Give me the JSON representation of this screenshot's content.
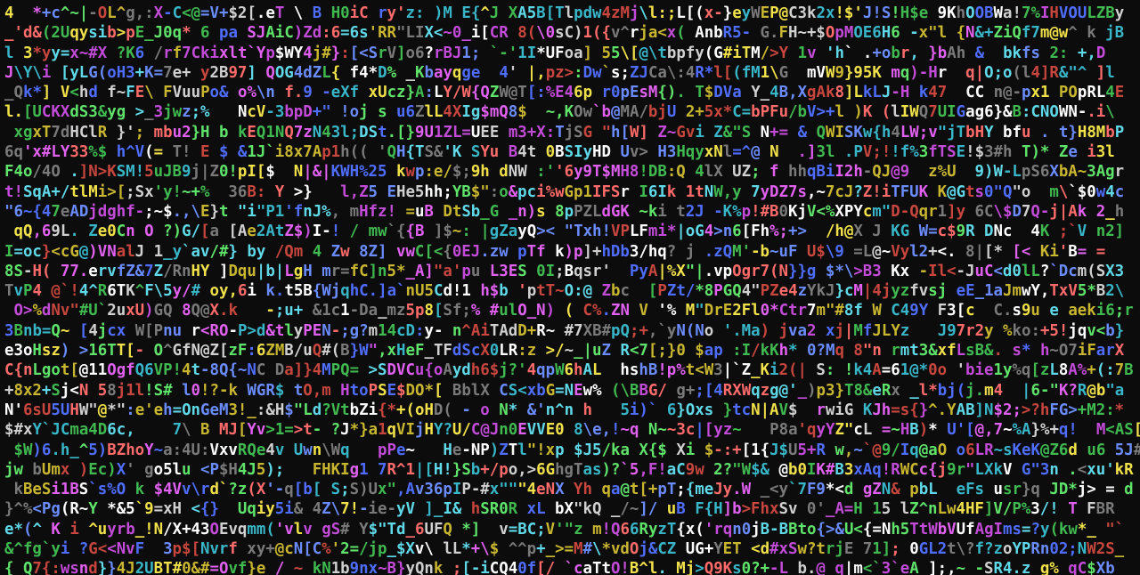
{
  "terminal": {
    "background": "#0c0c0c",
    "palette": [
      "#c7463e",
      "#3fb950",
      "#c9b630",
      "#4f6dff",
      "#c24bd8",
      "#38b6c8",
      "#d0d0d0",
      "#7a7a7a",
      "#ff6b6b",
      "#5fe36a",
      "#f0e04a",
      "#6b8cff",
      "#e060f0",
      "#5fd8e8",
      "#ffffff"
    ],
    "lines": [
      "4  *+c^~|-OL^g,:X-C<@=V+$2[.eT \\ B H0iC ry'z: )M E{^J XA5B[Tlpdw4zMj\\l:;L[(x-}eyWEP@C3k2x!$'J!S!H$e 9KhOOBWa!7%IHVOULZBy",
      "_'d&(2Uqysib>pE_J0q* 6 pa SJAiC)Zd:6=6s'RR\"LIX<~0_i[CR 8(\\0sC)1({v^rja<x( AnbR5- G.FH~+$OpMOE6H6 -x\"l {N&+ZiQf7m@w^ k jB",
      "l 3*yy=x~#X ?K6 /rf7Ckixlt`Yp$WY4j#}:[<SrV]o6?rBJ1; `-'1I*UFoa] 55\\[@\\tbpfy(G#iTM/>Y 1v 'h` .+obr, }bAh &  bkfs 2: +,D",
      "J\\Y\\i [yLG(oH3+K=7e+ y2B97] QOG4dZL{ f4*D% _Kbayqge  4' |,pz>:Dw`s;ZJCa\\:4R*l[(fM1\\G  mVW9}95K mq)-Hr  q|O;o(l4]R&\"^ ]l",
      "_Qk*] V<hd f~FE\\ FVuuPo& o%\\n f.9 -eXf xUcz}A:LY/W{QZW@T[:%E46p r0pEsM{). T$DVa Y_4B,XgAk8]LkLJ-H k47  CC n@-px1 POpRL4E",
      "l.[UCKXdS3&yg >_3jwz;%   NcV-3bpD+\" !oj s u6ZlL4XIg$mQ8$  ~,KOw`b@MA/bjU 2+5x*C=bPFu/bV>+l )K (lIWQ7UIGag6}&B:CNOWN-.i\\",
      " xgxT7dHClR }'; mbu2}H b kEQ1NQ7zN43l;DSt.[}9U1ZL=UEE m3+X:TjSG \"h[W] Z~Gvi Z&\"S N+= & QWISKw{h4LW;v\"jTbHY bfu . t}H8MbP",
      "6q'x#LY33%$ h^V(= T! E $ &1J`i8x7Ap1h(( 'QH{TS&'K SYu B4t 0BSIyHD Uv> H3HqyxNl=^@ N  .]3l .PV;!!f%3fTSE!$3#h T)* Ze i3l",
      "F4o/4O .]N>KSM!5uJB9j|Z0!pI[$  N|&|KWH%25 kwp:e/$;9h dNW :''6y9T$MH8!DB:Q 4lX UZ; f hhqBiI2h-QJ@9  z%U  9)W-LpS6XbA~3Agr",
      "t!SqA+/tlMi>[;Sx'y!~+%  36B: Y >}   l,Z5 EHe5hh;YB$\":o&pci%wGp1IFSr I6Ik 1tNW,y 7yDZ7s,~7cJ?Z!iTFUK K@Gts0\"Q\"o  m\\`$0w4c",
      "\"6~{47eADjdghf-;~$.,\\E}t \"i\"P1'fnJ%, mHfz! =uB DtSb_G _n)s 8pPZLdGK ~ki t2J -K%p!#B0KjV<%XPYcm\"D-Qqr1]y 6C\\$D7Q-j|Ak 2_h",
      " qQ,69L. Ze0Cn O ?)G/[a [Ae2AtZ$)I-! / mw`{{B ]$~: |gZayQ>< \"Txh!VPLFmi*|oG4>n6[Fh%;+>  /h@X J KG W=c$9R DNc  4K ;`V n2]",
      "I=oc}<cG@)VNalJ 1_y`av/#} by /Qm 4 Zw 8Z] vwC[<{0EJ.zw pTf k)p]+hDb3/hq? j .zQM'-b~uF U$\\9 =L@~Vyl2+<. 8|[* [< Ki'B= =",
      "8S-H( 77.ervfZ&7Z/RnHY ]Dqu|b|LgH mr=fC]n5*_A]\"a'pu L3ES 0I;Bqsr'  PyA|%X\"|.vpOgr7(N}}g $*\\>B3 Kx -Il<-JuC<d0lL?`Dcm(SX3",
      "TvP4 @`!4^R6TK^F\\5y/# oy,6i k.t5B{WjqhC.]a`nU5Cd!1 h$b 'ptT~O:@ Zbc  [PZt/*8PGQ4\"PZe4zYkJ}cM|4jyzfvsj eE_1aJmwY,TxV5*B2\\",
      " O>%dNv\"#U`2uxU)GQ 8Q@X.k   -;u+ &1c1-Da_mz5p8[Sf;% #ulO_N) ( C%.ZN V '% M\"DrE2Fl0*Ctr7m\"#8f W C49Y F3[c  C.s9u e aeki6;r",
      "3Bnb=Q~ [4jcx W[Pnu r<RO-P>d&tlyPEN-;g?m14cD:y- n^AiTAdD+R~ #7XB#pQ;+,`yN(No '.Ma) jva2 xj|MfJLYz   J97r2y %ko:+5!jqv<b}",
      "e3oHsz) >16TT[- O^GfN@Z[zF:6ZMB/uQ#(B}W\",xHeF_TFdScX0LR:z >/~_|uZ R<7[;}0 $ap :I/kKh* 0?Mq 8\"n rmt3&xfLsB&. s* h~O7iFarX",
      "C{nLgot[@11OgfQ6VP!4t-8Q{~NC Da]}4MPQ= >SDVCu{oAydh6$j?'4qpW6hAL  hshB!p%t<W3|`Z_Ki2(| S: !k4A=61@*0o 'bie1y%q[zL8A%+(:7B",
      "+8x2+Sj<N 58j1l!S# l0!?-k WGR$ tO,m HtoPSE$DO*[ BblX CS<xbG=NEw% (\\BBG/ g+;[4RXWqzg@'_)p3}T8&eRx _l*bj(j.m4  |6-\"K?R@b\"a",
      "N'6sU5UHW\"@*\":e'eh=OnGeM3!_:&H$\"Ld?VtbZi{*+(oHD( - o N* &'n^n h   5i)` 6}Oxs }tcN|AV$  rwiG KJh=s{}^.YAB]N$2;>?hFG>+M2:*",
      "$#xY`JCma4D6c,    7\\ B MJ[Yv>1=>t- ?J*}a1qVIjHY?U/C@Jn0EVVE0 8\\e,!~q N~~3c|[yz~   P8a'qyYZ\"cL =~HB)* U'[@,7~%A}%+q!  M<AS[",
      " $W)6.h_^5)BZhoY~a:4U:VxvRQe4v Uwn\\Wq   pPe~   He-NP)ZTl\"!xp $J5/ka X{$ Xi $-:+[1{J$U5+R w,~`@9/Iq@aO o6LR~sKeK@Z6d u6 5J#",
      "jw bUmx )Ec)X' go5lu <P$H4J5);   FHKIg1 7R^1|[H!}Sb+/po,>6GhgTas)?`5,F!aC9w 2?\"W$& @b0IK#B3xAq!RWCc{j9r\"LXkV G\"3n .<xu'kR",
      " kBeSi1BS`s%O k $4Vv\\rd`?z(X'-q[b[ S;S)Ux\",Av36pIP-#x\"\"\"4eNX Yh qa@t[+pT;{meJy.W _<y`7F9*<d gZN& pbL  eFs usr}q JD*j> = d",
      "}^%<Pg(R~Y *&5`9=xH <{}  Uqiy5i& 4Z\\7!-ie-yV ]_I& hSR0R xL bX\"kQ _/~]/ uB F{H]b>FhxSv 0'_A=H 15 lZ^nLw4HF]V/P%3/! T FBR",
      "e*(^ K i ^uyrb_!N/X+43OEvqmm('vlv gS# Y$\"Td_6UFQ *]  v=BC;V'\"z m!Q66RyzT{x('rqn0jB-BBto{>&U<{=Nh5TtWbVUfAgIms=?y(kw*_ \"`",
      "&^fg`yi ?G<<NvF  3p$[Nvrf xy+@cN[C%'2=/jp_$Xv\\ lL*+\\$ ^^p+_>=M#\\*vdOj&CZ UG+YET <d#xSw?trjE 71]; 0GL2t\\?f?zoYPRn02;NW2S_",
      "{ Q7{:wsnd}}4J2UBT#0&#=Ovf}e / ~ kN1b9nx~B}yQnk ;[-iCQ40f[/ `caTtO!B^l._Mj>Q9Ks0?+-L_b.@ q|m<`3`eA ];,~ -SR4.z g% qC$Xb"
    ]
  }
}
